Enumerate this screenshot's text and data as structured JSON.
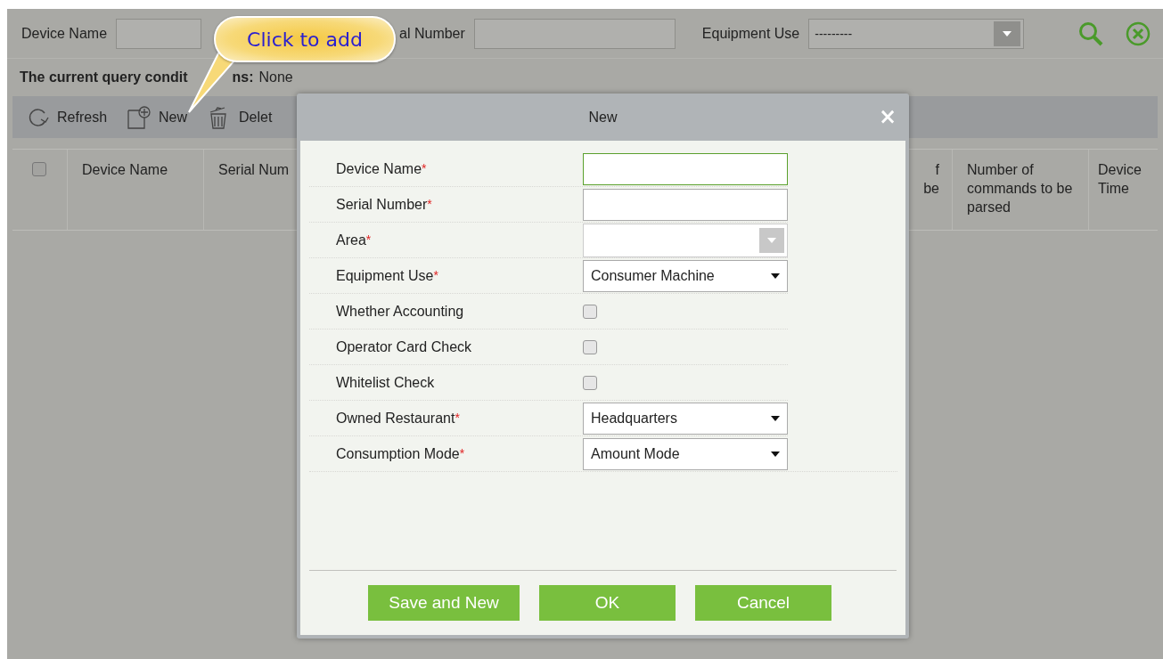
{
  "filters": [
    {
      "label": "Device Name",
      "kind": "text"
    },
    {
      "label": "al Number",
      "kind": "text"
    },
    {
      "label": "Equipment Use",
      "kind": "combo",
      "value": "---------"
    }
  ],
  "query": {
    "label_parts": [
      "The current query condit",
      "ns:"
    ],
    "value": "None"
  },
  "toolbar": [
    {
      "label": "Refresh",
      "kind": "refresh"
    },
    {
      "label": "New",
      "kind": "new"
    },
    {
      "label": "Delet",
      "kind": "delete"
    }
  ],
  "table": {
    "columns": [
      {
        "kind": "checkbox",
        "checked": false
      },
      {
        "label": "Device Name",
        "kind": "text"
      },
      {
        "label": "Serial Num",
        "kind": "text"
      },
      {
        "label": "f\nbe",
        "kind": "hidden"
      },
      {
        "label": "Number of commands to be parsed",
        "kind": "text"
      },
      {
        "label": "Device Time",
        "kind": "text"
      }
    ]
  },
  "callout": {
    "text": "Click to add"
  },
  "dialog": {
    "title": "New",
    "close": "×",
    "fields": [
      {
        "label": "Device Name",
        "required_mark": "*",
        "kind": "text",
        "focused": true
      },
      {
        "label": "Serial Number",
        "required_mark": "*",
        "kind": "text",
        "focused": false
      },
      {
        "label": "Area",
        "required_mark": "*",
        "kind": "combo"
      },
      {
        "label": "Equipment Use",
        "required_mark": "*",
        "kind": "select",
        "value": "Consumer Machine"
      },
      {
        "label": "Whether Accounting",
        "kind": "checkbox",
        "checked": false
      },
      {
        "label": "Operator Card Check",
        "kind": "checkbox",
        "checked": false
      },
      {
        "label": "Whitelist Check",
        "kind": "checkbox",
        "checked": false
      },
      {
        "label": "Owned Restaurant",
        "required_mark": "*",
        "kind": "select",
        "value": "Headquarters"
      },
      {
        "label": "Consumption Mode",
        "required_mark": "*",
        "kind": "select",
        "value": "Amount Mode"
      }
    ],
    "buttons": [
      "Save and New",
      "OK",
      "Cancel"
    ]
  }
}
